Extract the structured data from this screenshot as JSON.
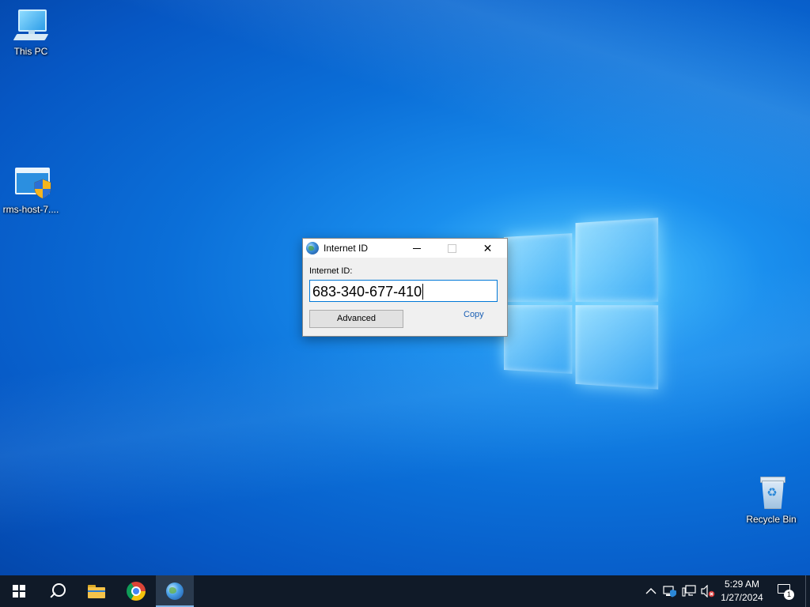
{
  "desktop": {
    "icons": [
      {
        "label": "This PC",
        "icon": "this-pc-icon"
      },
      {
        "label": "rms-host-7....",
        "icon": "installer-shield-icon"
      },
      {
        "label": "Recycle Bin",
        "icon": "recycle-bin-icon"
      }
    ]
  },
  "dialog": {
    "title": "Internet ID",
    "title_icon": "globe-icon",
    "field_label": "Internet ID:",
    "id_value": "683-340-677-410",
    "advanced_label": "Advanced",
    "copy_label": "Copy",
    "minimize_symbol": "",
    "close_symbol": "✕"
  },
  "taskbar": {
    "items": [
      {
        "name": "start",
        "icon": "windows-start-icon"
      },
      {
        "name": "search",
        "icon": "search-icon"
      },
      {
        "name": "file-explorer",
        "icon": "folder-icon"
      },
      {
        "name": "chrome",
        "icon": "chrome-icon"
      },
      {
        "name": "internet-id-app",
        "icon": "globe-icon",
        "active": true
      }
    ],
    "tray": {
      "chevron": "^",
      "icons": [
        "network-shield-icon",
        "network-icon",
        "volume-muted-icon"
      ]
    },
    "clock": {
      "time": "5:29 AM",
      "date": "1/27/2024"
    },
    "notifications_count": "1"
  },
  "colors": {
    "taskbar_bg": "#101a28",
    "accent": "#0078d7",
    "link": "#1a5fb4"
  }
}
